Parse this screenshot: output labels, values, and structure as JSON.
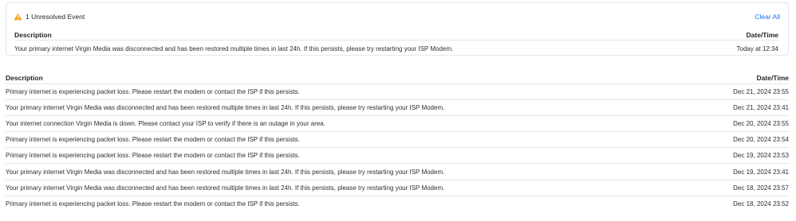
{
  "unresolved": {
    "title": "1 Unresolved Event",
    "clear_all": "Clear All",
    "headers": {
      "description": "Description",
      "datetime": "Date/Time"
    },
    "rows": [
      {
        "description": "Your primary internet Virgin Media was disconnected and has been restored multiple times in last 24h. If this persists, please try restarting your ISP Modem.",
        "datetime": "Today at 12:34"
      }
    ],
    "icon": "warning-triangle-icon",
    "warn_color": "#f5a623"
  },
  "history": {
    "headers": {
      "description": "Description",
      "datetime": "Date/Time"
    },
    "rows": [
      {
        "description": "Primary internet is experiencing packet loss. Please restart the modem or contact the ISP if this persists.",
        "datetime": "Dec 21, 2024 23:55"
      },
      {
        "description": "Your primary internet Virgin Media was disconnected and has been restored multiple times in last 24h. If this persists, please try restarting your ISP Modem.",
        "datetime": "Dec 21, 2024 23:41"
      },
      {
        "description": "Your internet connection Virgin Media is down. Please contact your ISP to verify if there is an outage in your area.",
        "datetime": "Dec 20, 2024 23:55"
      },
      {
        "description": "Primary internet is experiencing packet loss. Please restart the modem or contact the ISP if this persists.",
        "datetime": "Dec 20, 2024 23:54"
      },
      {
        "description": "Primary internet is experiencing packet loss. Please restart the modem or contact the ISP if this persists.",
        "datetime": "Dec 19, 2024 23:53"
      },
      {
        "description": "Your primary internet Virgin Media was disconnected and has been restored multiple times in last 24h. If this persists, please try restarting your ISP Modem.",
        "datetime": "Dec 19, 2024 23:41"
      },
      {
        "description": "Your primary internet Virgin Media was disconnected and has been restored multiple times in last 24h. If this persists, please try restarting your ISP Modem.",
        "datetime": "Dec 18, 2024 23:57"
      },
      {
        "description": "Primary internet is experiencing packet loss. Please restart the modem or contact the ISP if this persists.",
        "datetime": "Dec 18, 2024 23:52"
      }
    ]
  },
  "colors": {
    "accent": "#1a73e8",
    "border": "#e3e6ea"
  }
}
